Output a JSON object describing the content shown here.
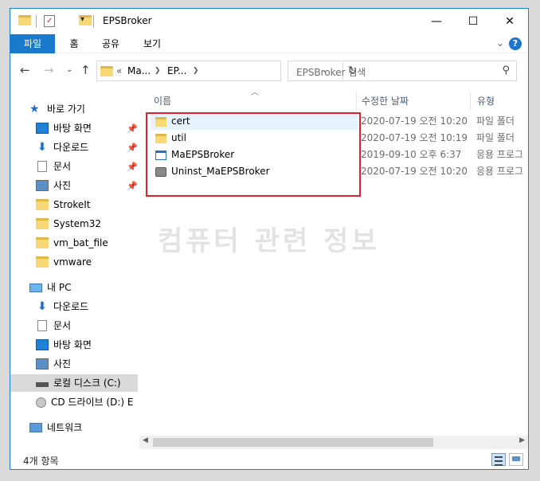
{
  "window": {
    "title": "EPSBroker"
  },
  "ribbon": {
    "tabs": [
      "파일",
      "홈",
      "공유",
      "보기"
    ],
    "help": "?"
  },
  "nav": {
    "address": {
      "overflow": "«",
      "segments": [
        "Ma...",
        "EP..."
      ]
    },
    "search_placeholder": "EPSBroker 검색"
  },
  "sidebar": {
    "items": [
      {
        "label": "바로 가기",
        "icon": "star-icon"
      },
      {
        "label": "바탕 화면",
        "icon": "desktop-icon",
        "pinned": true
      },
      {
        "label": "다운로드",
        "icon": "download-icon",
        "pinned": true
      },
      {
        "label": "문서",
        "icon": "document-icon",
        "pinned": true
      },
      {
        "label": "사진",
        "icon": "pictures-icon",
        "pinned": true
      },
      {
        "label": "StrokeIt",
        "icon": "folder-icon"
      },
      {
        "label": "System32",
        "icon": "folder-icon"
      },
      {
        "label": "vm_bat_file",
        "icon": "folder-icon"
      },
      {
        "label": "vmware",
        "icon": "folder-icon"
      },
      {
        "label": "내 PC",
        "icon": "pc-icon"
      },
      {
        "label": "다운로드",
        "icon": "download-icon"
      },
      {
        "label": "문서",
        "icon": "document-icon"
      },
      {
        "label": "바탕 화면",
        "icon": "desktop-icon"
      },
      {
        "label": "사진",
        "icon": "pictures-icon"
      },
      {
        "label": "로컬 디스크 (C:)",
        "icon": "drive-icon",
        "selected": true
      },
      {
        "label": "CD 드라이브 (D:) E",
        "icon": "cd-drive-icon"
      },
      {
        "label": "네트워크",
        "icon": "network-icon"
      }
    ]
  },
  "columns": {
    "name": "이름",
    "date": "수정한 날짜",
    "type": "유형"
  },
  "files": [
    {
      "name": "cert",
      "date": "2020-07-19 오전 10:20",
      "type": "파일 폴더",
      "icon": "folder-icon"
    },
    {
      "name": "util",
      "date": "2020-07-19 오전 10:19",
      "type": "파일 폴더",
      "icon": "folder-icon"
    },
    {
      "name": "MaEPSBroker",
      "date": "2019-09-10 오후 6:37",
      "type": "응용 프로그램",
      "icon": "application-icon"
    },
    {
      "name": "Uninst_MaEPSBroker",
      "date": "2020-07-19 오전 10:20",
      "type": "응용 프로그램",
      "icon": "uninstaller-icon"
    }
  ],
  "watermark": "컴퓨터 관련 정보",
  "status": {
    "count": "4개 항목"
  }
}
